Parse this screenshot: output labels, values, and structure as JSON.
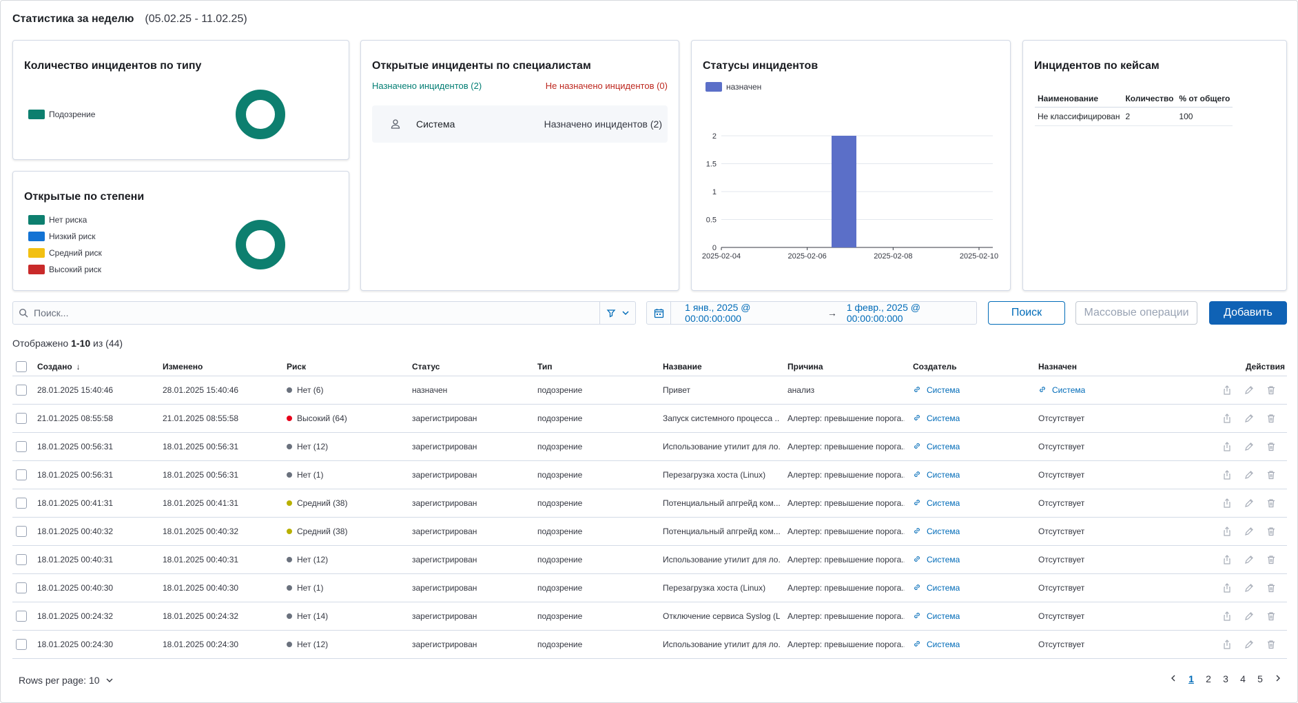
{
  "header": {
    "title": "Статистика за неделю",
    "period": "(05.02.25 - 11.02.25)"
  },
  "by_type": {
    "title": "Количество инцидентов по типу",
    "legend": [
      {
        "label": "Подозрение",
        "color": "#0d7f6f"
      }
    ]
  },
  "by_severity": {
    "title": "Открытые по степени",
    "legend": [
      {
        "label": "Нет риска",
        "color": "#0d7f6f"
      },
      {
        "label": "Низкий риск",
        "color": "#1373d4"
      },
      {
        "label": "Средний риск",
        "color": "#f2c012"
      },
      {
        "label": "Высокий риск",
        "color": "#c92a2a"
      }
    ]
  },
  "by_specialist": {
    "title": "Открытые инциденты по специалистам",
    "assigned": "Назначено инцидентов (2)",
    "unassigned": "Не назначено инцидентов (0)",
    "items": [
      {
        "name": "Система",
        "count": "Назначено инцидентов (2)"
      }
    ]
  },
  "statuses": {
    "title": "Статусы инцидентов",
    "legend": "назначен"
  },
  "chart_data": {
    "type": "bar",
    "title": "Статусы инцидентов",
    "series": [
      {
        "name": "назначен",
        "color": "#5b6fc8",
        "points": [
          {
            "x": "2025-02-07",
            "y": 2
          }
        ]
      }
    ],
    "x_ticks": [
      "2025-02-04",
      "2025-02-06",
      "2025-02-08",
      "2025-02-10"
    ],
    "y_ticks": [
      "0",
      "0.5",
      "1",
      "1.5",
      "2"
    ],
    "ylim": [
      0,
      2
    ],
    "grid": "horizontal",
    "legend_position": "top-left"
  },
  "by_cases": {
    "title": "Инцидентов по кейсам",
    "columns": [
      "Наименование",
      "Количество",
      "% от общего"
    ],
    "rows": [
      [
        "Не классифицирован",
        "2",
        "100"
      ]
    ]
  },
  "toolbar": {
    "search_placeholder": "Поиск...",
    "date_start": "1 янв., 2025 @ 00:00:00:000",
    "date_arrow": "→",
    "date_end": "1 февр., 2025 @ 00:00:00:000",
    "search_btn": "Поиск",
    "bulk_btn": "Массовые операции",
    "add_btn": "Добавить"
  },
  "shown": {
    "prefix": "Отображено",
    "range": "1-10",
    "mid": "из",
    "total": "(44)"
  },
  "table": {
    "columns": [
      "Создано",
      "Изменено",
      "Риск",
      "Статус",
      "Тип",
      "Название",
      "Причина",
      "Создатель",
      "Назначен",
      "Действия"
    ],
    "sort_arrow": "↓",
    "rows": [
      {
        "created": "28.01.2025 15:40:46",
        "modified": "28.01.2025 15:40:46",
        "risk": "Нет (6)",
        "risk_color": "#6a717d",
        "status": "назначен",
        "type": "подозрение",
        "name": "Привет",
        "reason": "анализ",
        "creator": "Система",
        "assignee": "Система",
        "assignee_link": true
      },
      {
        "created": "21.01.2025 08:55:58",
        "modified": "21.01.2025 08:55:58",
        "risk": "Высокий (64)",
        "risk_color": "#e7001a",
        "status": "зарегистрирован",
        "type": "подозрение",
        "name": "Запуск системного процесса ...",
        "reason": "Алертер: превышение порога...",
        "creator": "Система",
        "assignee": "Отсутствует",
        "assignee_link": false
      },
      {
        "created": "18.01.2025 00:56:31",
        "modified": "18.01.2025 00:56:31",
        "risk": "Нет (12)",
        "risk_color": "#6a717d",
        "status": "зарегистрирован",
        "type": "подозрение",
        "name": "Использование утилит для ло...",
        "reason": "Алертер: превышение порога...",
        "creator": "Система",
        "assignee": "Отсутствует",
        "assignee_link": false
      },
      {
        "created": "18.01.2025 00:56:31",
        "modified": "18.01.2025 00:56:31",
        "risk": "Нет (1)",
        "risk_color": "#6a717d",
        "status": "зарегистрирован",
        "type": "подозрение",
        "name": "Перезагрузка хоста (Linux)",
        "reason": "Алертер: превышение порога...",
        "creator": "Система",
        "assignee": "Отсутствует",
        "assignee_link": false
      },
      {
        "created": "18.01.2025 00:41:31",
        "modified": "18.01.2025 00:41:31",
        "risk": "Средний (38)",
        "risk_color": "#b8b000",
        "status": "зарегистрирован",
        "type": "подозрение",
        "name": "Потенциальный апгрейд ком...",
        "reason": "Алертер: превышение порога...",
        "creator": "Система",
        "assignee": "Отсутствует",
        "assignee_link": false
      },
      {
        "created": "18.01.2025 00:40:32",
        "modified": "18.01.2025 00:40:32",
        "risk": "Средний (38)",
        "risk_color": "#b8b000",
        "status": "зарегистрирован",
        "type": "подозрение",
        "name": "Потенциальный апгрейд ком...",
        "reason": "Алертер: превышение порога...",
        "creator": "Система",
        "assignee": "Отсутствует",
        "assignee_link": false
      },
      {
        "created": "18.01.2025 00:40:31",
        "modified": "18.01.2025 00:40:31",
        "risk": "Нет (12)",
        "risk_color": "#6a717d",
        "status": "зарегистрирован",
        "type": "подозрение",
        "name": "Использование утилит для ло...",
        "reason": "Алертер: превышение порога...",
        "creator": "Система",
        "assignee": "Отсутствует",
        "assignee_link": false
      },
      {
        "created": "18.01.2025 00:40:30",
        "modified": "18.01.2025 00:40:30",
        "risk": "Нет (1)",
        "risk_color": "#6a717d",
        "status": "зарегистрирован",
        "type": "подозрение",
        "name": "Перезагрузка хоста (Linux)",
        "reason": "Алертер: превышение порога...",
        "creator": "Система",
        "assignee": "Отсутствует",
        "assignee_link": false
      },
      {
        "created": "18.01.2025 00:24:32",
        "modified": "18.01.2025 00:24:32",
        "risk": "Нет (14)",
        "risk_color": "#6a717d",
        "status": "зарегистрирован",
        "type": "подозрение",
        "name": "Отключение сервиса Syslog (L...",
        "reason": "Алертер: превышение порога...",
        "creator": "Система",
        "assignee": "Отсутствует",
        "assignee_link": false
      },
      {
        "created": "18.01.2025 00:24:30",
        "modified": "18.01.2025 00:24:30",
        "risk": "Нет (12)",
        "risk_color": "#6a717d",
        "status": "зарегистрирован",
        "type": "подозрение",
        "name": "Использование утилит для ло...",
        "reason": "Алертер: превышение порога...",
        "creator": "Система",
        "assignee": "Отсутствует",
        "assignee_link": false
      }
    ]
  },
  "pagination": {
    "rows_per_page": "Rows per page: 10",
    "pages": [
      "1",
      "2",
      "3",
      "4",
      "5"
    ],
    "current": "1"
  },
  "icons": {
    "search": "search-icon",
    "filter": "filter-icon",
    "calendar": "calendar-icon",
    "link": "link-icon",
    "share": "share-icon",
    "edit": "pencil-icon",
    "delete": "trash-icon",
    "user": "user-icon"
  },
  "accent": "#006bb8"
}
